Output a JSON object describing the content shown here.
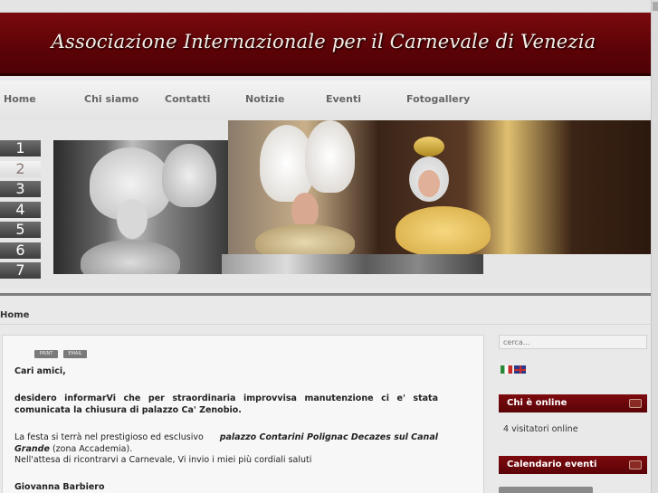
{
  "header": {
    "title": "Associazione Internazionale per il Carnevale di Venezia"
  },
  "nav": {
    "items": [
      {
        "label": "Home"
      },
      {
        "label": "Chi siamo"
      },
      {
        "label": "Contatti"
      },
      {
        "label": "Notizie"
      },
      {
        "label": "Eventi"
      },
      {
        "label": "Fotogallery"
      }
    ]
  },
  "slider": {
    "tabs": [
      "1",
      "2",
      "3",
      "4",
      "5",
      "6",
      "7"
    ],
    "active_tab": "2"
  },
  "breadcrumb": {
    "current": "Home"
  },
  "article": {
    "print_label": "PRINT",
    "email_label": "EMAIL",
    "greeting": "Cari amici,",
    "p1_line1": "desidero informarVi che per straordinaria improvvisa manutenzione ci e' stata",
    "p1_line2": "comunicata la chiusura di palazzo Ca' Zenobio.",
    "p2_prefix": "La festa si terrà nel prestigioso ed esclusivo",
    "p2_venue_a": "palazzo Contarini Polignac Decazes sul Canal",
    "p2_venue_b": "Grande",
    "p2_suffix": "(zona Accademia).",
    "p3": "Nell'attesa di ricontrarvi a Carnevale, Vi invio i miei più cordiali saluti",
    "signature": "Giovanna Barbiero"
  },
  "sidebar": {
    "search_placeholder": "cerca...",
    "languages": [
      "italian-flag",
      "english-flag"
    ],
    "modules": [
      {
        "title": "Chi è online",
        "text": "4 visitatori online"
      },
      {
        "title": "Calendario eventi",
        "text": ""
      }
    ]
  },
  "colors": {
    "accent": "#6a0508",
    "nav_text": "#666666",
    "background": "#e9e9e9"
  }
}
